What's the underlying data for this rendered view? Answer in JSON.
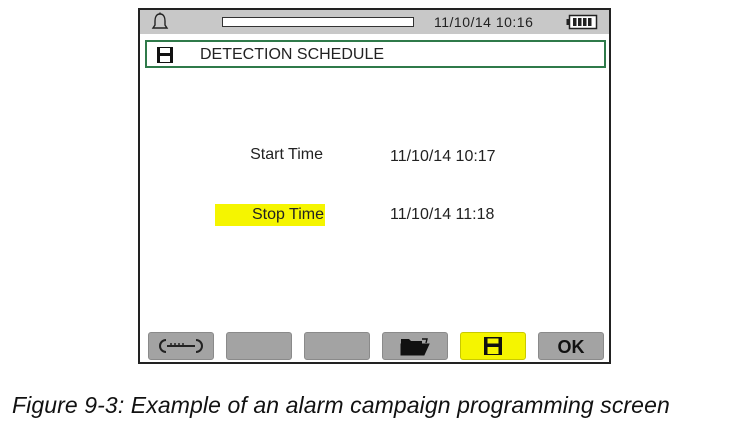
{
  "status_bar": {
    "datetime": "11/10/14  10:16",
    "icons": [
      "bell-icon",
      "battery-icon"
    ]
  },
  "header": {
    "title": "DETECTION SCHEDULE",
    "icon": "floppy-disk-icon"
  },
  "schedule": {
    "start_label": "Start Time",
    "start_value": "11/10/14 10:17",
    "stop_label": "Stop Time",
    "stop_value": "11/10/14 11:18"
  },
  "softkeys": {
    "items": [
      {
        "icon": "wrench-icon",
        "label": ""
      },
      {
        "icon": "",
        "label": ""
      },
      {
        "icon": "",
        "label": ""
      },
      {
        "icon": "open-folder-icon",
        "label": ""
      },
      {
        "icon": "floppy-disk-icon",
        "label": ""
      },
      {
        "icon": "",
        "label": "OK"
      }
    ],
    "highlight_color": "#f5f500"
  },
  "caption": "Figure 9-3: Example of an alarm campaign programming screen",
  "colors": {
    "status_bar_bg": "#c8c8c8",
    "title_border": "#2f7a4a",
    "highlight": "#f5f500",
    "softkey_bg": "#a3a3a3"
  }
}
